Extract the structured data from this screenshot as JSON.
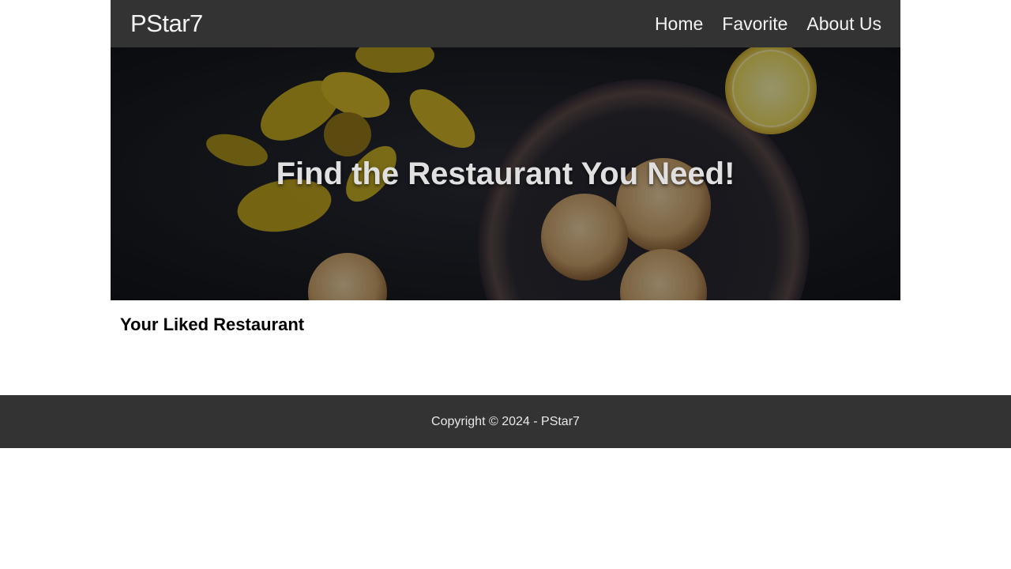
{
  "header": {
    "brand": "PStar7",
    "nav": [
      {
        "label": "Home"
      },
      {
        "label": "Favorite"
      },
      {
        "label": "About Us"
      }
    ]
  },
  "hero": {
    "title": "Find the Restaurant You Need!"
  },
  "main": {
    "section_title": "Your Liked Restaurant"
  },
  "footer": {
    "copyright": "Copyright © 2024 - PStar7"
  },
  "colors": {
    "navbar_bg": "#333333",
    "footer_bg": "#333333",
    "hero_bg": "#1a1d24",
    "text_light": "#f2f2f2"
  }
}
